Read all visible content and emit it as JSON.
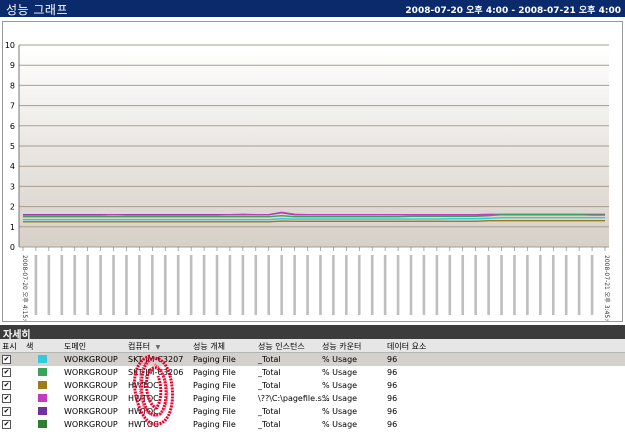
{
  "window": {
    "title": "성능 그래프",
    "date_range": "2008-07-20 오후 4:00 - 2008-07-21 오후 4:00"
  },
  "chart_data": {
    "type": "line",
    "ylim": [
      0,
      10
    ],
    "y_ticks": [
      "0",
      "1",
      "2",
      "3",
      "4",
      "5",
      "6",
      "7",
      "8",
      "9",
      "10"
    ],
    "grid": true,
    "x_tick_count": 46,
    "x": [
      "2008-07-20 오후 4:15:00",
      "",
      "",
      "",
      "",
      "",
      "",
      "",
      "",
      "",
      "",
      "",
      "",
      "",
      "",
      "",
      "",
      "",
      "",
      "",
      "",
      "",
      "",
      "",
      "",
      "",
      "",
      "",
      "",
      "",
      "",
      "",
      "",
      "",
      "",
      "",
      "",
      "",
      "",
      "",
      "",
      "",
      "",
      "",
      "",
      "2008-07-21 오후 3:45:00"
    ],
    "series": [
      {
        "color": "#7030a0",
        "values": [
          1.6,
          1.6,
          1.6,
          1.6,
          1.6,
          1.6,
          1.6,
          1.6,
          1.6,
          1.6,
          1.6,
          1.6,
          1.6,
          1.6,
          1.6,
          1.6,
          1.6,
          1.6,
          1.6,
          1.6,
          1.7,
          1.6,
          1.6,
          1.6,
          1.6,
          1.6,
          1.6,
          1.6,
          1.6,
          1.6,
          1.6,
          1.6,
          1.6,
          1.6,
          1.6,
          1.6,
          1.6,
          1.6,
          1.6,
          1.6,
          1.6,
          1.6,
          1.6,
          1.6,
          1.6,
          1.6
        ]
      },
      {
        "color": "#c23bc2",
        "values": [
          1.58,
          1.58,
          1.58,
          1.58,
          1.58,
          1.58,
          1.58,
          1.6,
          1.58,
          1.58,
          1.58,
          1.58,
          1.58,
          1.58,
          1.58,
          1.58,
          1.6,
          1.62,
          1.6,
          1.6,
          1.72,
          1.62,
          1.6,
          1.6,
          1.6,
          1.6,
          1.6,
          1.6,
          1.6,
          1.6,
          1.6,
          1.6,
          1.6,
          1.6,
          1.6,
          1.6,
          1.62,
          1.62,
          1.62,
          1.62,
          1.62,
          1.62,
          1.62,
          1.62,
          1.62,
          1.62
        ]
      },
      {
        "color": "#3aa35a",
        "values": [
          1.5,
          1.5,
          1.5,
          1.5,
          1.5,
          1.5,
          1.5,
          1.5,
          1.5,
          1.5,
          1.5,
          1.5,
          1.5,
          1.5,
          1.5,
          1.5,
          1.5,
          1.5,
          1.5,
          1.5,
          1.55,
          1.5,
          1.5,
          1.5,
          1.5,
          1.5,
          1.5,
          1.5,
          1.5,
          1.5,
          1.52,
          1.52,
          1.52,
          1.52,
          1.52,
          1.52,
          1.55,
          1.6,
          1.6,
          1.6,
          1.6,
          1.6,
          1.6,
          1.6,
          1.58,
          1.58
        ]
      },
      {
        "color": "#33c9e0",
        "values": [
          1.35,
          1.35,
          1.35,
          1.35,
          1.35,
          1.35,
          1.35,
          1.35,
          1.35,
          1.35,
          1.35,
          1.35,
          1.35,
          1.35,
          1.35,
          1.35,
          1.35,
          1.35,
          1.35,
          1.35,
          1.4,
          1.38,
          1.38,
          1.38,
          1.38,
          1.38,
          1.38,
          1.38,
          1.38,
          1.38,
          1.38,
          1.38,
          1.38,
          1.4,
          1.4,
          1.4,
          1.42,
          1.45,
          1.45,
          1.45,
          1.45,
          1.45,
          1.45,
          1.45,
          1.45,
          1.45
        ]
      },
      {
        "color": "#9c7d1a",
        "values": [
          1.25,
          1.25,
          1.25,
          1.25,
          1.25,
          1.25,
          1.25,
          1.25,
          1.25,
          1.25,
          1.25,
          1.25,
          1.25,
          1.25,
          1.25,
          1.25,
          1.25,
          1.25,
          1.25,
          1.25,
          1.28,
          1.27,
          1.27,
          1.27,
          1.27,
          1.27,
          1.27,
          1.27,
          1.27,
          1.27,
          1.27,
          1.27,
          1.27,
          1.27,
          1.27,
          1.27,
          1.3,
          1.3,
          1.3,
          1.3,
          1.3,
          1.3,
          1.3,
          1.3,
          1.3,
          1.3
        ]
      }
    ]
  },
  "details": {
    "title": "자세히",
    "columns": [
      "표시",
      "색",
      "도메인",
      "컴퓨터",
      "성능 개체",
      "성능 인스턴스",
      "성능 카운터",
      "데이터 요소"
    ],
    "rows": [
      {
        "show": "✔",
        "color": "#33c9e0",
        "domain": "WORKGROUP",
        "computer": "SKT-JM-C3207",
        "object": "Paging File",
        "instance": "_Total",
        "counter": "% Usage",
        "points": "96"
      },
      {
        "show": "✔",
        "color": "#3aa35a",
        "domain": "WORKGROUP",
        "computer": "SKT-JM-C3206",
        "object": "Paging File",
        "instance": "_Total",
        "counter": "% Usage",
        "points": "96"
      },
      {
        "show": "✔",
        "color": "#9c7d1a",
        "domain": "WORKGROUP",
        "computer": "HWTOC",
        "object": "Paging File",
        "instance": "_Total",
        "counter": "% Usage",
        "points": "96"
      },
      {
        "show": "✔",
        "color": "#c23bc2",
        "domain": "WORKGROUP",
        "computer": "HWTOC",
        "object": "Paging File",
        "instance": "\\??\\C:\\pagefile.s...",
        "counter": "% Usage",
        "points": "96"
      },
      {
        "show": "✔",
        "color": "#7030a0",
        "domain": "WORKGROUP",
        "computer": "HWTOC",
        "object": "Paging File",
        "instance": "_Total",
        "counter": "% Usage",
        "points": "96"
      },
      {
        "show": "✔",
        "color": "#2e7d32",
        "domain": "WORKGROUP",
        "computer": "HWTOC",
        "object": "Paging File",
        "instance": "_Total",
        "counter": "% Usage",
        "points": "96"
      }
    ],
    "sort_icon": "sort-down-icon"
  }
}
